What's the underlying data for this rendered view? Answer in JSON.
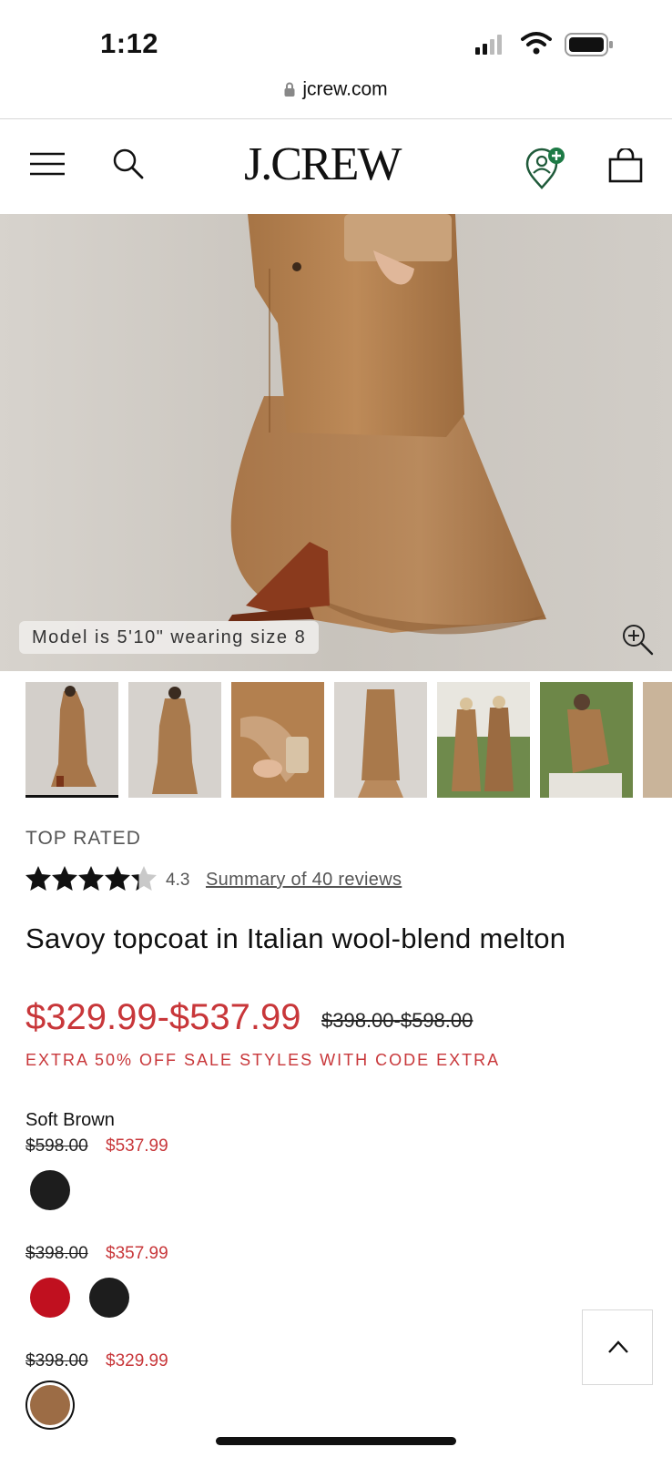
{
  "status_bar": {
    "time": "1:12"
  },
  "browser": {
    "url": "jcrew.com"
  },
  "header": {
    "logo": "J.CREW"
  },
  "hero": {
    "model_note": "Model is 5'10\" wearing size 8"
  },
  "product": {
    "badge": "TOP RATED",
    "rating": "4.3",
    "rating_value": 4.3,
    "reviews_link": "Summary of 40 reviews",
    "title": "Savoy topcoat in Italian wool-blend melton",
    "price_range": "$329.99-$537.99",
    "original_range": "$398.00-$598.00",
    "promo": "EXTRA 50% OFF SALE STYLES WITH CODE EXTRA",
    "selected_color": "Soft Brown",
    "price_groups": [
      {
        "original": "$598.00",
        "sale": "$537.99"
      },
      {
        "original": "$398.00",
        "sale": "$357.99"
      },
      {
        "original": "$398.00",
        "sale": "$329.99"
      }
    ]
  },
  "colors": {
    "sale_red": "#c8373a",
    "swatch_black": "#1d1d1d",
    "swatch_red": "#c0101f",
    "swatch_soft_brown": "#9c6c45"
  }
}
